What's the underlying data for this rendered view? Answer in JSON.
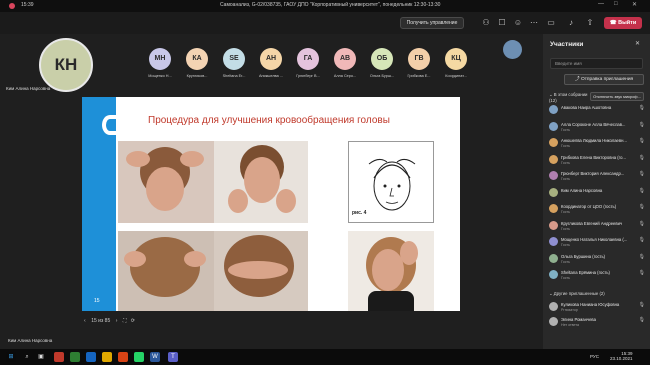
{
  "titlebar": {
    "time": "15:39",
    "title": "Самоанализ, G-02/038735, ГАОУ ДПО \"Корпоративный университет\", понедельник 12:30-13:30",
    "minimize": "—",
    "maximize": "□",
    "close": "✕"
  },
  "toolbar": {
    "control_label": "Получить управление",
    "leave_label": "Выйти"
  },
  "stage": {
    "main_speaker": {
      "initials": "КН",
      "name": "Ким Алина Нарсовна",
      "color": "#c9cfa9"
    },
    "participants": [
      {
        "initials": "МН",
        "name": "Мощенко Н...",
        "color": "#c8c7e8"
      },
      {
        "initials": "КА",
        "name": "Кругликов...",
        "color": "#f3d3b3"
      },
      {
        "initials": "SE",
        "name": "Sheltana Er...",
        "color": "#c3dde6"
      },
      {
        "initials": "АН",
        "name": "Аникшелва ...",
        "color": "#f5d6a8"
      },
      {
        "initials": "ГА",
        "name": "Грюнберг В...",
        "color": "#e4c3dd"
      },
      {
        "initials": "АВ",
        "name": "Алла Серо...",
        "color": "#f0b8b8"
      },
      {
        "initials": "ОБ",
        "name": "Ольга Бурш...",
        "color": "#d6e6b8"
      },
      {
        "initials": "ГВ",
        "name": "Грибкова Е...",
        "color": "#f3cfa9"
      },
      {
        "initials": "КЦ",
        "name": "Координат...",
        "color": "#f5d9a3"
      }
    ],
    "slide": {
      "title": "Процедура для улучшения кровообращения головы",
      "number": "15",
      "figure_label": "рис. 4"
    },
    "slide_nav": {
      "counter": "15 из 85"
    },
    "presenter_name": "Ким Алина Нарсовна"
  },
  "panel": {
    "title": "Участники",
    "search_placeholder": "Введите имя",
    "invite_label": "Отправка приглашения",
    "in_meeting_label": "В этом собрании",
    "in_meeting_count": "(12)",
    "mute_all_label": "Отключить звук микроф...",
    "participants": [
      {
        "name": "Авакова Наира Ашотовна",
        "role": "",
        "color": "#7fa1c4"
      },
      {
        "name": "Алла Сороконе Алла Вячеслав...",
        "role": "Гость",
        "color": "#7fa1c4"
      },
      {
        "name": "Анюшелва Людмила Николаевн...",
        "role": "Гость",
        "color": "#d6a15f"
      },
      {
        "name": "Грибкова Елена Викторовна (го...",
        "role": "Гость",
        "color": "#d6a15f"
      },
      {
        "name": "Грюнберг Виктория Александр...",
        "role": "Гость",
        "color": "#b07fb0"
      },
      {
        "name": "Ким Алина Нарсовна",
        "role": "",
        "color": "#a7b07f"
      },
      {
        "name": "Координатор от ЦОО (гость)",
        "role": "Гость",
        "color": "#d6a15f"
      },
      {
        "name": "Кругликова Евгений Андреевич",
        "role": "Гость",
        "color": "#d69a8a"
      },
      {
        "name": "Мощенко Наталья Николаевна (...",
        "role": "Гость",
        "color": "#8f8fd0"
      },
      {
        "name": "Ольга Буршина (гость)",
        "role": "Гость",
        "color": "#8fb08f"
      },
      {
        "name": "Sheltana Ерёмина (гость)",
        "role": "Гость",
        "color": "#7fb0c4"
      }
    ],
    "others_label": "Другие приглашенные (2)",
    "others": [
      {
        "name": "Куликова Наниана Юсуфовна",
        "role": "Ргпизатор",
        "color": "#b0b0b0"
      },
      {
        "name": "Элина Романчева",
        "role": "Нет ответа",
        "color": "#b0b0b0"
      }
    ]
  },
  "taskbar": {
    "lang": "РУС",
    "time": "15:39",
    "date": "23.10.2021"
  }
}
